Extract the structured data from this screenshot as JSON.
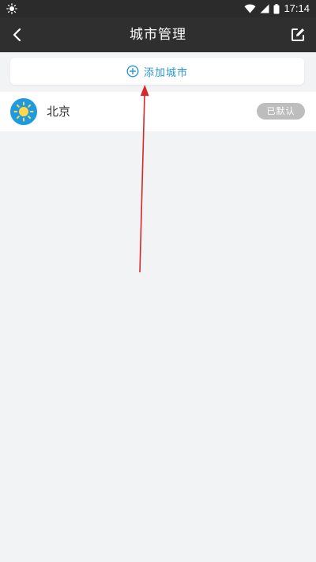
{
  "status_bar": {
    "time": "17:14",
    "icons": [
      "sun-icon",
      "wifi-icon",
      "signal-icon",
      "battery-icon"
    ]
  },
  "title_bar": {
    "title": "城市管理",
    "back_icon": "chevron-left-icon",
    "edit_icon": "edit-icon"
  },
  "add_city": {
    "label": "添加城市",
    "icon": "plus-circle-icon",
    "color": "#2a96d6"
  },
  "cities": [
    {
      "name": "北京",
      "weather_icon": "sun-icon",
      "badge": "已默认"
    }
  ],
  "colors": {
    "header_bg": "#2f2f2f",
    "page_bg": "#f2f3f5",
    "accent": "#2a96d6",
    "weather_icon_bg": "#1e9be0",
    "badge_bg": "#bdbdbd",
    "annotation_arrow": "#d8272b"
  }
}
